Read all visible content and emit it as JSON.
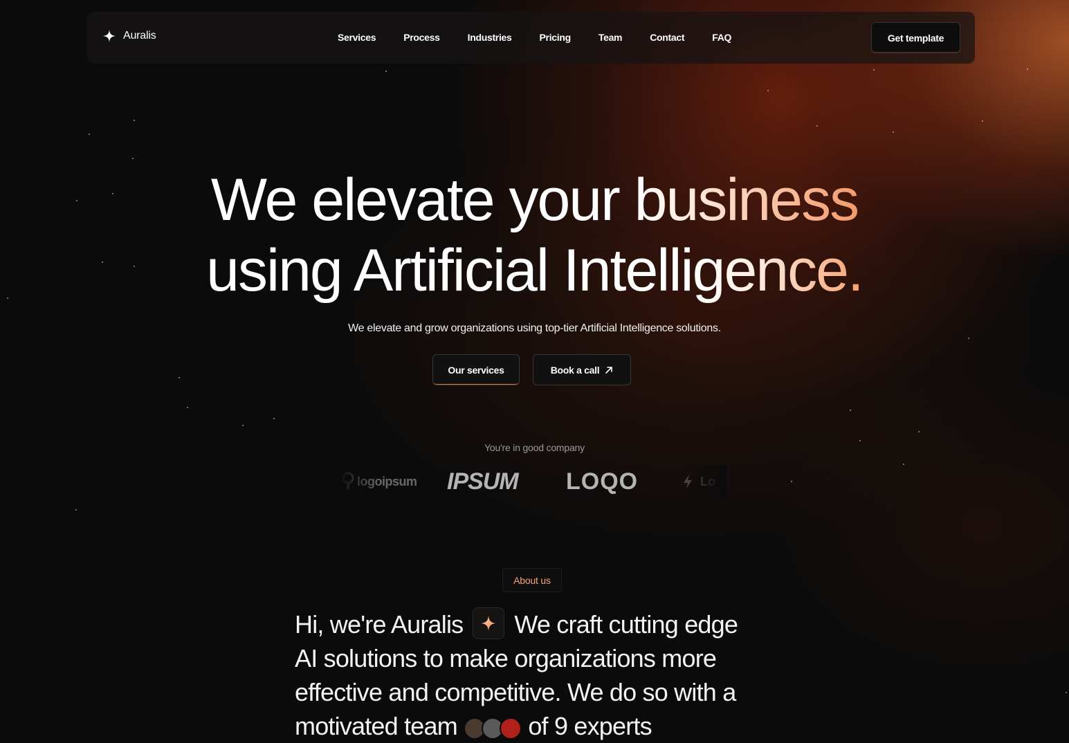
{
  "brand": {
    "name": "Auralis",
    "icon": "sparkle-icon"
  },
  "nav": {
    "links": [
      "Services",
      "Process",
      "Industries",
      "Pricing",
      "Team",
      "Contact",
      "FAQ"
    ],
    "cta_label": "Get template"
  },
  "hero": {
    "title_line1_plain": "We elevate your ",
    "title_line1_accent": "business",
    "title_line2_plain": "using Artificial Intelli",
    "title_line2_accent": "gence.",
    "subtitle": "We elevate and grow organizations using top-tier Artificial Intelligence solutions.",
    "primary_button": "Our services",
    "secondary_button": "Book a call",
    "secondary_icon": "arrow-up-right-icon"
  },
  "social_proof": {
    "label": "You're in good company",
    "logos": [
      "logoipsum",
      "IPSUM",
      "LOQO",
      "Lo"
    ]
  },
  "about": {
    "badge": "About us",
    "line1_start": "Hi, we're Auralis",
    "line1_end": "We craft cutting edge",
    "line2": "AI solutions to make organizations more",
    "line3": "effective and competitive. We do so with a",
    "line4_start": "motivated team",
    "line4_end": "of 9 experts",
    "inline_icon": "sparkle-icon"
  },
  "colors": {
    "background": "#0b0b0b",
    "accent": "#f39a6a",
    "glow": "#cd642d"
  }
}
